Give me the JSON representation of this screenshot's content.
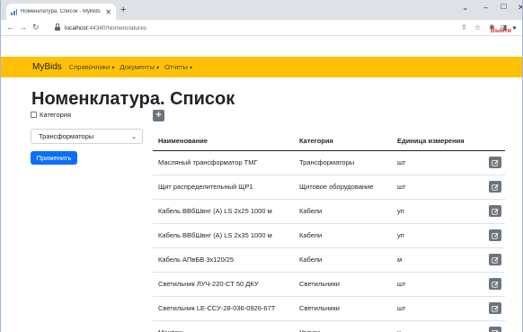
{
  "browser": {
    "tab_title": "Номенклатура. Список - MyBids",
    "tab_close": "✕",
    "new_tab": "+",
    "url_host": "localhost",
    "url_path": ":44340/Nomenclatures",
    "logout": "Выйти"
  },
  "navbar": {
    "brand": "MyBids",
    "links": [
      {
        "label": "Справочники",
        "caret": "▾"
      },
      {
        "label": "Документы",
        "caret": "▾"
      },
      {
        "label": "Отчеты",
        "caret": "▾"
      }
    ]
  },
  "page": {
    "title": "Номенклатура. Список",
    "category_checkbox_label": "Категория",
    "category_checked": false,
    "category_select_value": "Трансформаторы",
    "apply_label": "Применить",
    "add_label": "+"
  },
  "table": {
    "headers": [
      "Наименование",
      "Категория",
      "Единица измерения"
    ],
    "rows": [
      [
        "Масляный трансформатор ТМГ",
        "Трансформаторы",
        "шт"
      ],
      [
        "Щит распределительный ЩР1",
        "Щитовое оборудование",
        "шт"
      ],
      [
        "Кабель ВВбШвнг (А) LS 2x25 1000 м",
        "Кабели",
        "уп"
      ],
      [
        "Кабель ВВбШвнг (А) LS 2x35 1000 м",
        "Кабели",
        "уп"
      ],
      [
        "Кабель АПвБВ 3х120/25",
        "Кабели",
        "м"
      ],
      [
        "Светильник ЛУЧ-220-СТ 50 ДКУ",
        "Светильники",
        "шт"
      ],
      [
        "Светильник LE-ССУ-28-036-0926-67Т",
        "Светильники",
        "шт"
      ],
      [
        "Монтаж",
        "Услуги",
        "ч"
      ]
    ]
  }
}
